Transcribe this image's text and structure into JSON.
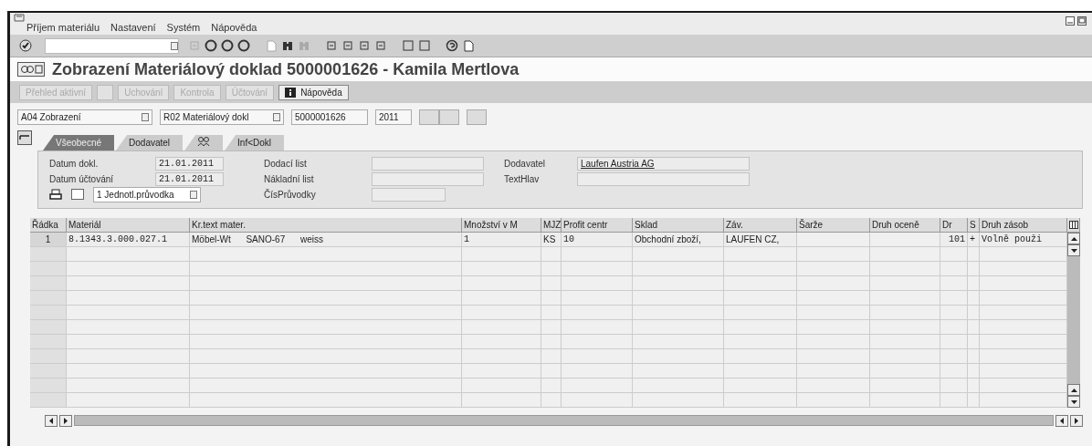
{
  "menu": [
    {
      "label": "Příjem materiálu"
    },
    {
      "label": "Nastavení"
    },
    {
      "label": "Systém"
    },
    {
      "label": "Nápověda"
    }
  ],
  "title": "Zobrazení Materiálový doklad 5000001626 - Kamila Mertlova",
  "app_toolbar": [
    {
      "label": "Přehled aktivní",
      "disabled": true,
      "kind": "text"
    },
    {
      "kind": "blank",
      "disabled": true
    },
    {
      "label": "Uchování",
      "disabled": true,
      "kind": "text"
    },
    {
      "label": "Kontrola",
      "disabled": true,
      "kind": "text"
    },
    {
      "label": "Účtování",
      "disabled": true,
      "kind": "text"
    },
    {
      "label": "Nápověda",
      "disabled": false,
      "kind": "info"
    }
  ],
  "selection": {
    "action": "A04 Zobrazení",
    "reference": "R02 Materiálový dokl",
    "document": "5000001626",
    "year": "2011"
  },
  "tabs": [
    {
      "label": "Všeobecné",
      "selected": true,
      "kind": "text"
    },
    {
      "label": "Dodavatel",
      "selected": false,
      "kind": "text"
    },
    {
      "selected": false,
      "kind": "icon"
    },
    {
      "label": "Inf<Dokl",
      "selected": false,
      "kind": "text"
    }
  ],
  "header_fields": {
    "left": [
      {
        "label": "Datum dokl.",
        "value": "21.01.2011"
      },
      {
        "label": "Datum účtování",
        "value": "21.01.2011"
      }
    ],
    "print": {
      "checked": false,
      "option": "1 Jednotl.průvodka"
    },
    "middle": [
      {
        "label": "Dodací list"
      },
      {
        "label": "Nákladní list"
      },
      {
        "label": "ČísPrůvodky"
      }
    ],
    "right": [
      {
        "label": "Dodavatel",
        "value": "Laufen Austria AG",
        "link": true
      },
      {
        "label": "TextHlav"
      }
    ]
  },
  "table": {
    "columns": [
      "Řádka",
      "Materiál",
      "Kr.text mater.",
      "Množství v M",
      "MJZ",
      "Profit centr",
      "Sklad",
      "Záv.",
      "Šarže",
      "Druh oceně",
      "Dr",
      "S",
      "Druh zásob"
    ],
    "rows": [
      {
        "cells": [
          "1",
          "8.1343.3.000.027.1",
          "Möbel-Wt      SANO-67      weiss",
          "1",
          "KS",
          "10",
          "Obchodní zboží,",
          "LAUFEN CZ,",
          null,
          null,
          "101",
          "+",
          "Volně použi"
        ]
      }
    ]
  }
}
